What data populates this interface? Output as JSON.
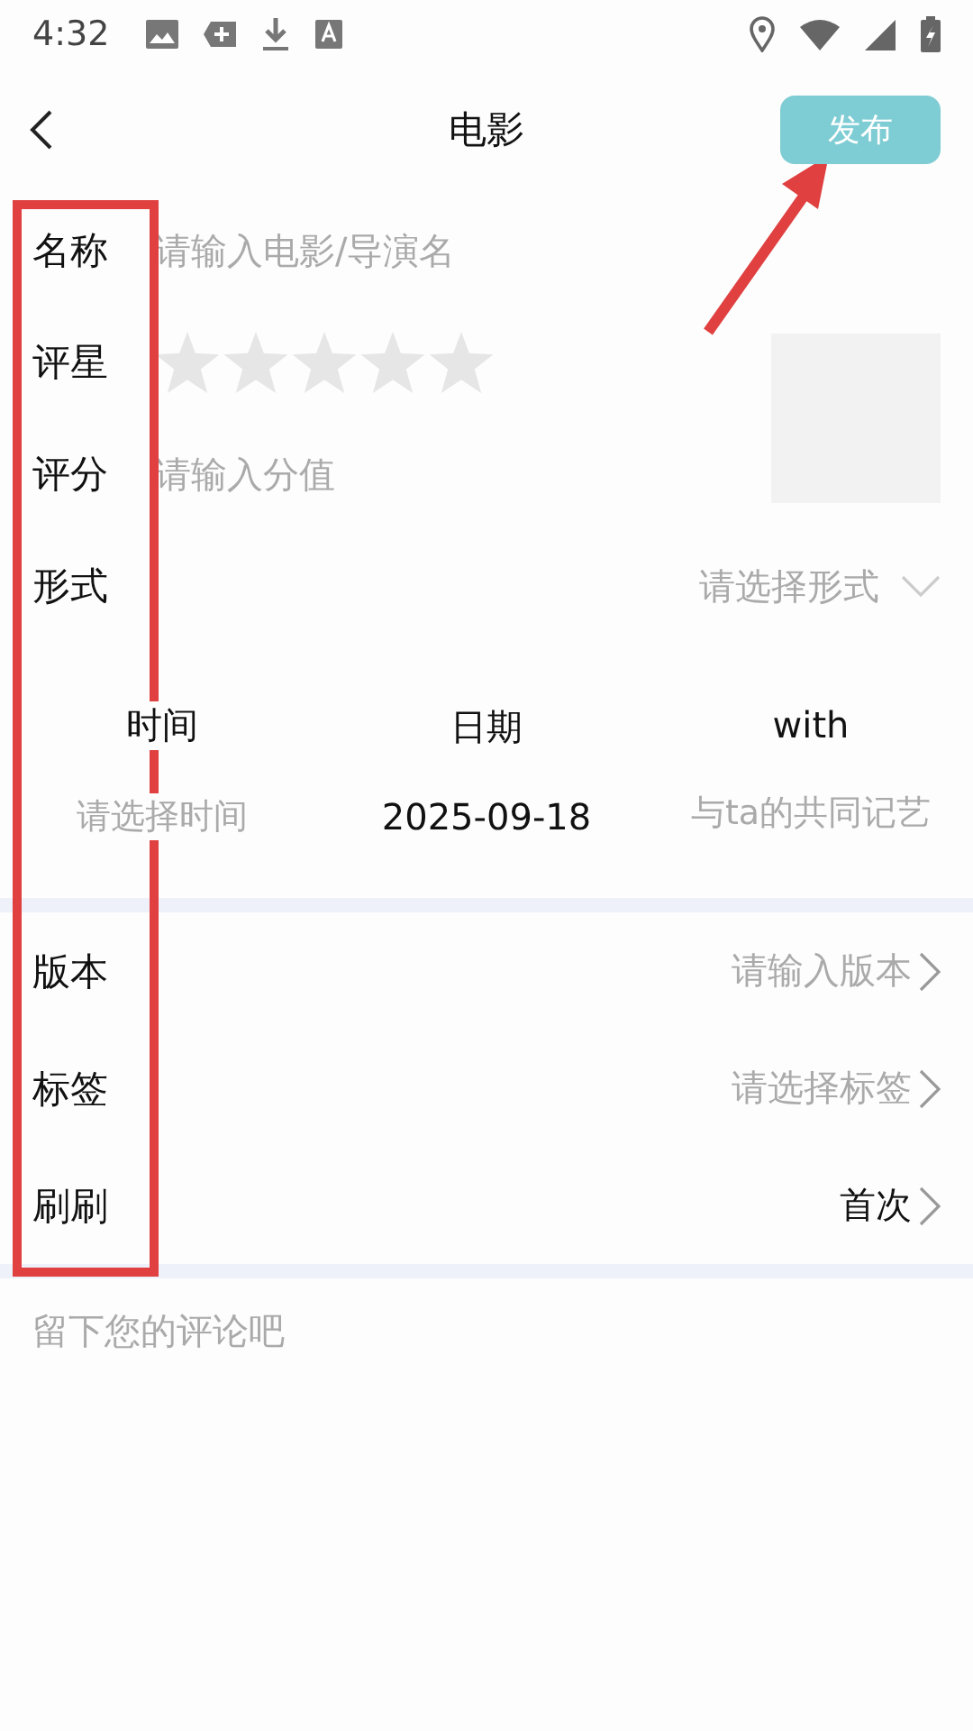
{
  "status_bar": {
    "time": "4:32"
  },
  "header": {
    "title": "电影",
    "publish_button": "发布"
  },
  "fields": [
    {
      "label": "名称",
      "kind": "input",
      "placeholder": "请输入电影/导演名"
    },
    {
      "label": "评星",
      "kind": "stars",
      "stars": 0
    },
    {
      "label": "评分",
      "kind": "input",
      "placeholder": "请输入分值"
    },
    {
      "label": "形式",
      "kind": "select",
      "placeholder": "请选择形式"
    }
  ],
  "columns": [
    {
      "title": "时间",
      "placeholder": "请选择时间"
    },
    {
      "title": "日期",
      "value": "2025-09-18"
    },
    {
      "title": "with",
      "placeholder": "与ta的共同记艺"
    }
  ],
  "details": [
    {
      "label": "版本",
      "placeholder": "请输入版本"
    },
    {
      "label": "标签",
      "placeholder": "请选择标签"
    },
    {
      "label": "刷刷",
      "value": "首次"
    }
  ],
  "comment": {
    "placeholder": "留下您的评论吧"
  }
}
